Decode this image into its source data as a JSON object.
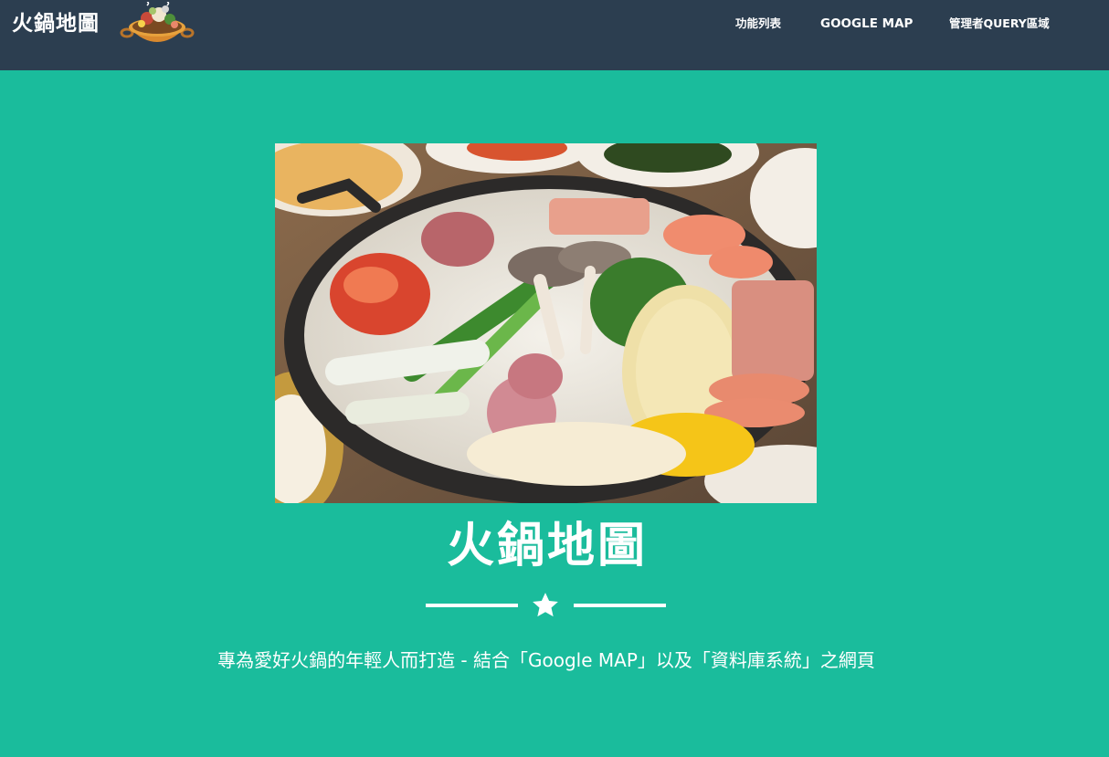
{
  "navbar": {
    "brand": "火鍋地圖",
    "logo_icon": "hotpot-logo-icon",
    "links": [
      {
        "label": "功能列表"
      },
      {
        "label": "GOOGLE MAP"
      },
      {
        "label": "管理者QUERY區域"
      }
    ]
  },
  "masthead": {
    "image_icon": "hotpot-photo",
    "title": "火鍋地圖",
    "divider_icon": "star-icon",
    "subtitle": "專為愛好火鍋的年輕人而打造 - 結合「Google MAP」以及「資料庫系統」之網頁"
  },
  "colors": {
    "navbar_bg": "#2c3e50",
    "page_bg": "#1abc9c",
    "text": "#ffffff"
  }
}
